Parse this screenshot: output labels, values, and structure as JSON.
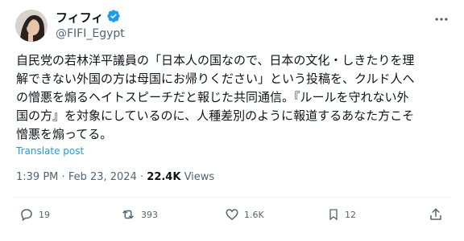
{
  "author": {
    "display_name": "フィフィ",
    "handle": "@FIFI_Egypt",
    "verified_icon": "verified-badge-icon",
    "accent_color": "#1d9bf0"
  },
  "tweet": {
    "text": "自民党の若林洋平議員の「日本人の国なので、日本の文化・しきたりを理\n解できない外国の方は母国にお帰りください」という投稿を、クルド人へ\nの憎悪を煽るヘイトスピーチだと報じた共同通信。『ルールを守れない外\n国の方』を対象にしているのに、人種差別のように報道するあなた方こそ\n憎悪を煽ってる。",
    "translate_label": "Translate post"
  },
  "meta": {
    "time": "1:39 PM",
    "separator": "·",
    "date": "Feb 23, 2024",
    "views_count": "22.4K",
    "views_label": "Views"
  },
  "actions": {
    "reply": {
      "icon": "reply-icon",
      "count": "19"
    },
    "retweet": {
      "icon": "retweet-icon",
      "count": "393"
    },
    "like": {
      "icon": "heart-icon",
      "count": "1.6K"
    },
    "bookmark": {
      "icon": "bookmark-icon",
      "count": "12"
    },
    "share": {
      "icon": "share-icon"
    }
  },
  "more_icon": "more-options-icon"
}
